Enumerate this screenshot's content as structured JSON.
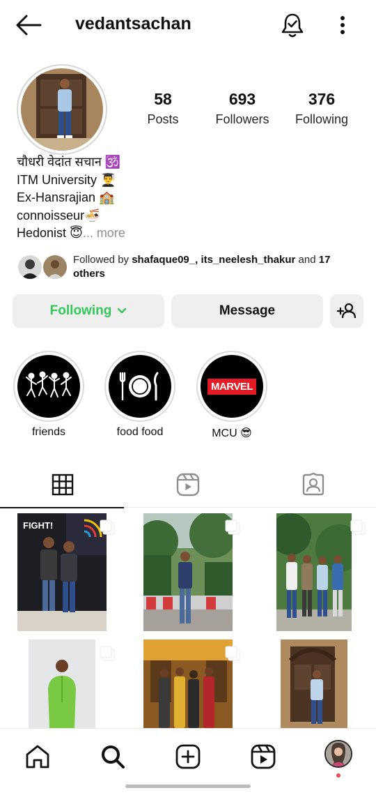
{
  "header": {
    "username": "vedantsachan",
    "back_icon": "arrow-left-icon",
    "bell_icon": "bell-check-icon",
    "more_icon": "kebab-menu-icon"
  },
  "stats": [
    {
      "value": "58",
      "label": "Posts"
    },
    {
      "value": "693",
      "label": "Followers"
    },
    {
      "value": "376",
      "label": "Following"
    }
  ],
  "bio": {
    "name_line": "चौधरी वेदांत सचान 🕉️",
    "lines": [
      "ITM University 👨‍🎓",
      "Ex-Hansrajian 🏫",
      "connoisseur🍜"
    ],
    "last_line": "Hedonist 😇",
    "more_label": "... more"
  },
  "followed_by": {
    "prefix": "Followed by ",
    "user1": "shafaque09_",
    "sep": ", ",
    "user2": "its_neelesh_thakur",
    "and": " and ",
    "others": "17 others"
  },
  "actions": {
    "following_label": "Following",
    "message_label": "Message",
    "add_user_icon": "person-add-icon"
  },
  "highlights": [
    {
      "label": "friends",
      "icon": "dancing-skeletons-icon"
    },
    {
      "label": "food food",
      "icon": "plate-fork-knife-icon"
    },
    {
      "label": "MCU 😎",
      "logo_text": "MARVEL"
    }
  ],
  "tabs": [
    "grid-icon",
    "reels-icon",
    "tagged-icon"
  ],
  "posts": [
    {
      "sign_text": "FIGHT!"
    },
    {},
    {},
    {},
    {},
    {}
  ],
  "bottom_nav": [
    "home-icon",
    "search-icon",
    "create-icon",
    "reels-icon",
    "profile-avatar"
  ],
  "colors": {
    "following_green": "#34c759",
    "notification_dot": "#ed4956",
    "button_bg": "#efefef"
  }
}
